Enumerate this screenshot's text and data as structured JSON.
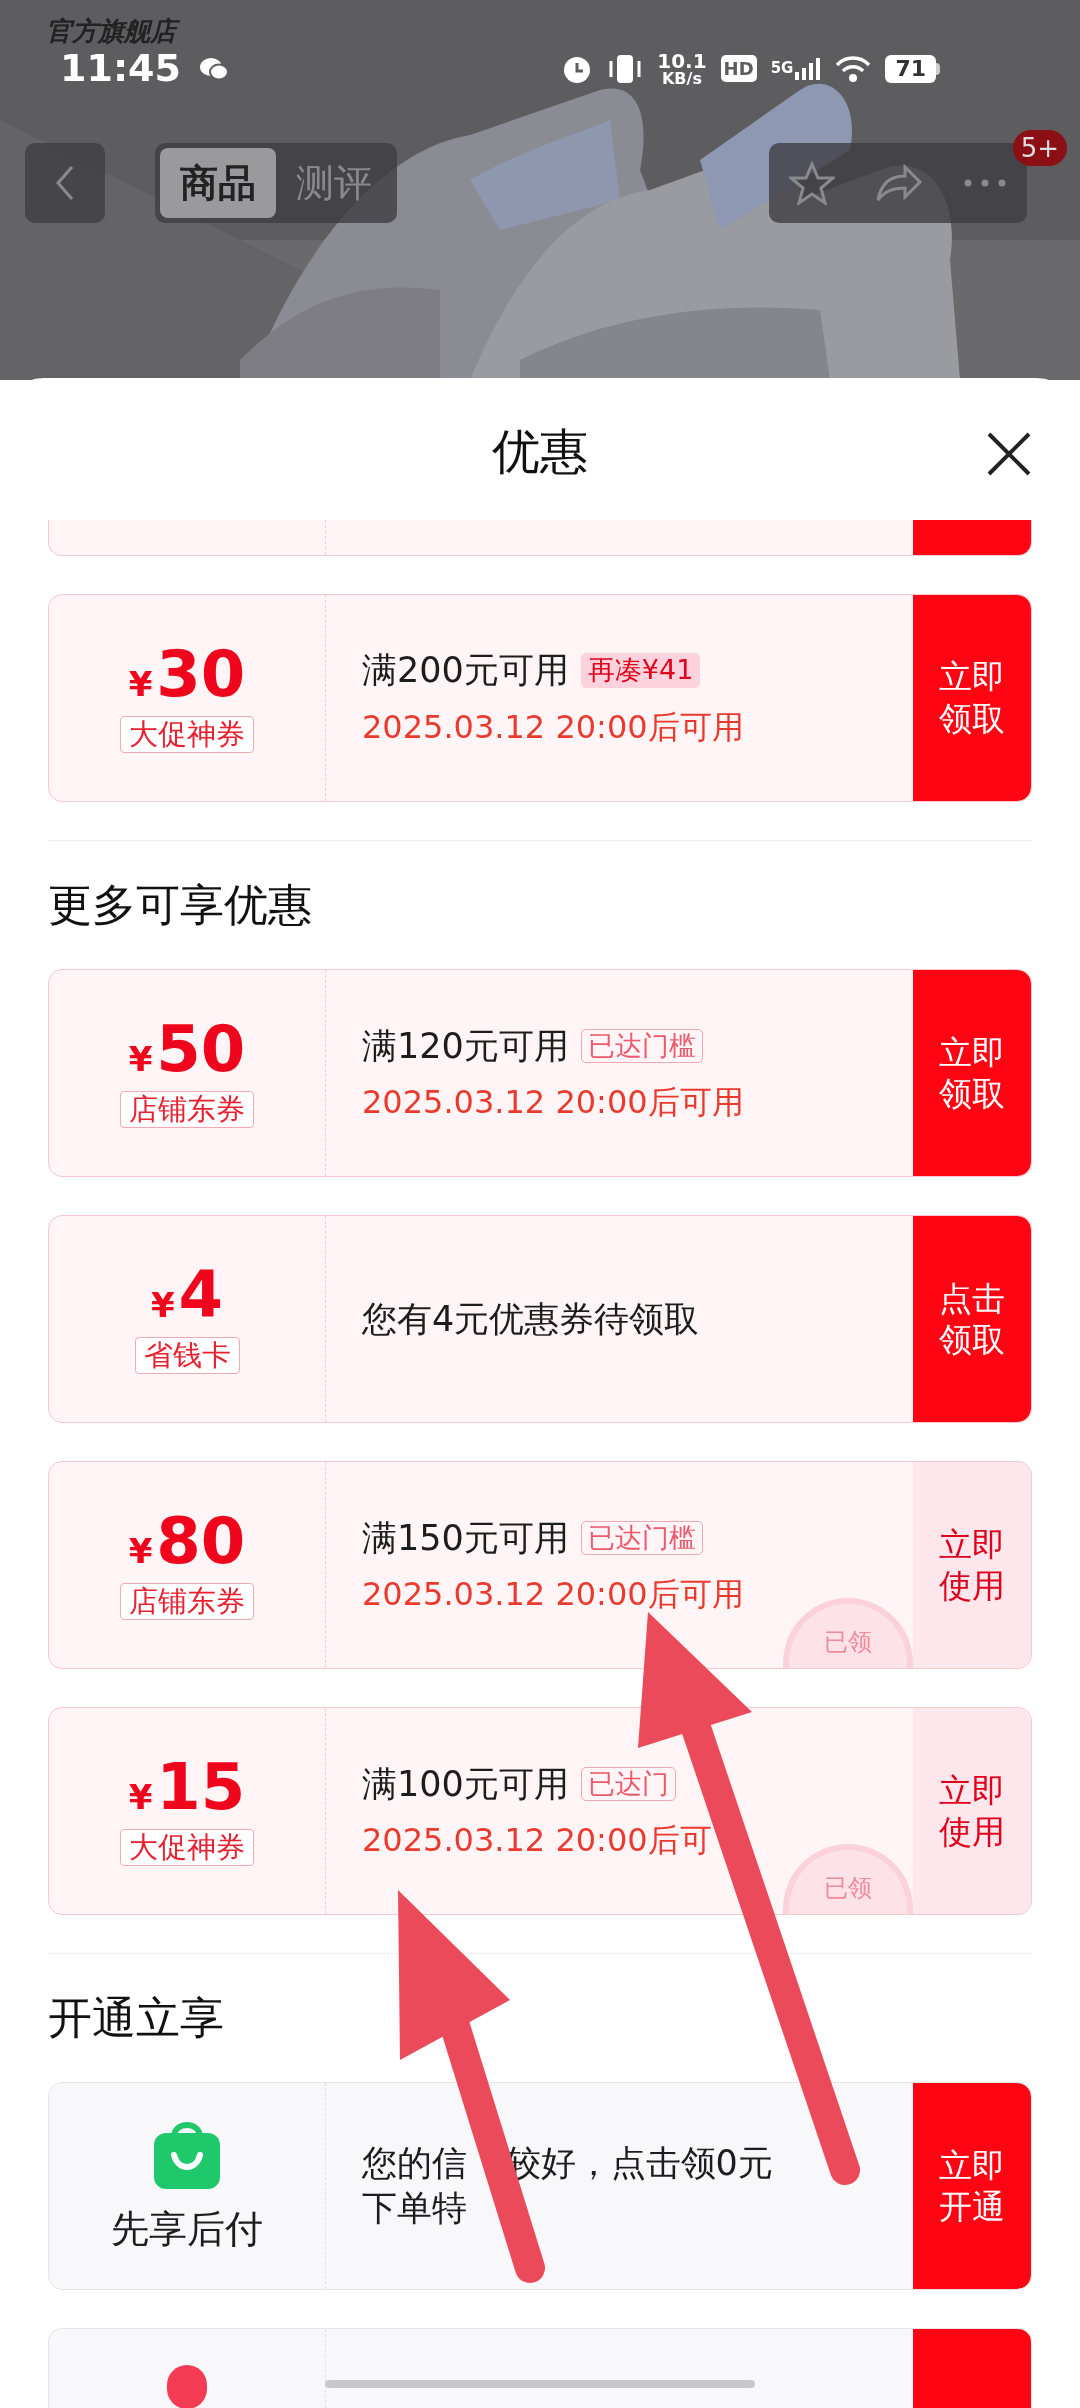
{
  "status_bar": {
    "store_label": "官方旗舰店",
    "time": "11:45",
    "speed_value": "10.1",
    "speed_unit": "KB/s",
    "hd": "HD",
    "network": "5G",
    "battery": "71"
  },
  "header": {
    "tabs": [
      {
        "label": "商品",
        "selected": true
      },
      {
        "label": "测评",
        "selected": false
      }
    ],
    "badge": "5+"
  },
  "sheet": {
    "title": "优惠",
    "top_coupons": [
      {
        "kind": "partial"
      },
      {
        "kind": "coupon",
        "currency": "¥",
        "amount": "30",
        "type_label": "大促神券",
        "condition": "满200元可用",
        "tag": {
          "text": "再凑¥41",
          "kind": "fill"
        },
        "time": "2025.03.12 20:00后可用",
        "button": "立即领取",
        "claimed": false
      }
    ],
    "more_section": {
      "title": "更多可享优惠",
      "coupons": [
        {
          "kind": "coupon",
          "currency": "¥",
          "amount": "50",
          "type_label": "店铺东券",
          "condition": "满120元可用",
          "tag": {
            "text": "已达门槛",
            "kind": "outline"
          },
          "time": "2025.03.12 20:00后可用",
          "button": "立即领取",
          "claimed": false
        },
        {
          "kind": "coupon",
          "currency": "¥",
          "amount": "4",
          "type_label": "省钱卡",
          "condition": "您有4元优惠券待领取",
          "button": "点击领取",
          "claimed": false
        },
        {
          "kind": "coupon",
          "currency": "¥",
          "amount": "80",
          "type_label": "店铺东券",
          "condition": "满150元可用",
          "tag": {
            "text": "已达门槛",
            "kind": "outline"
          },
          "time": "2025.03.12 20:00后可用",
          "button": "立即使用",
          "claimed": true,
          "stamp": "已领"
        },
        {
          "kind": "coupon",
          "currency": "¥",
          "amount": "15",
          "type_label": "大促神券",
          "condition": "满100元可用",
          "tag": {
            "text": "已达门",
            "kind": "outline"
          },
          "time": "2025.03.12 20:00后可",
          "button": "立即使用",
          "claimed": true,
          "stamp": "已领"
        }
      ]
    },
    "open_section": {
      "title": "开通立享",
      "cards": [
        {
          "kind": "service",
          "label": "先享后付",
          "text_parts": [
            "您的信",
            "较好，点击领0元"
          ],
          "text_line_2": "下单特",
          "button": "立即开通"
        },
        {
          "kind": "partial"
        }
      ]
    }
  }
}
